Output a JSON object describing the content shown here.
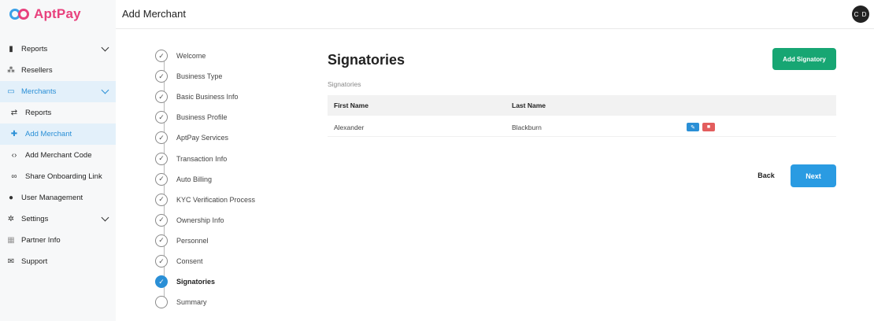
{
  "brand": {
    "name": "AptPay",
    "logo_icon": "aptpay-logo-icon"
  },
  "header": {
    "title": "Add Merchant",
    "avatar_initials": "C D"
  },
  "sidebar": {
    "items": [
      {
        "label": "Reports",
        "icon": "document-icon",
        "has_chevron": true
      },
      {
        "label": "Resellers",
        "icon": "network-icon"
      },
      {
        "label": "Merchants",
        "icon": "wallet-icon",
        "has_chevron": true,
        "active": true
      },
      {
        "label": "Reports",
        "icon": "swap-icon",
        "sub": true
      },
      {
        "label": "Add Merchant",
        "icon": "user-plus-icon",
        "sub": true,
        "active": true
      },
      {
        "label": "Add Merchant Code",
        "icon": "code-icon",
        "sub": true
      },
      {
        "label": "Share Onboarding Link",
        "icon": "link-icon",
        "sub": true
      },
      {
        "label": "User Management",
        "icon": "users-icon"
      },
      {
        "label": "Settings",
        "icon": "gear-icon",
        "has_chevron": true
      },
      {
        "label": "Partner Info",
        "icon": "grid-icon"
      },
      {
        "label": "Support",
        "icon": "mail-icon"
      }
    ]
  },
  "steps": [
    {
      "label": "Welcome",
      "state": "done"
    },
    {
      "label": "Business Type",
      "state": "done"
    },
    {
      "label": "Basic Business Info",
      "state": "done"
    },
    {
      "label": "Business Profile",
      "state": "done"
    },
    {
      "label": "AptPay Services",
      "state": "done"
    },
    {
      "label": "Transaction Info",
      "state": "done"
    },
    {
      "label": "Auto Billing",
      "state": "done"
    },
    {
      "label": "KYC Verification Process",
      "state": "done"
    },
    {
      "label": "Ownership Info",
      "state": "done"
    },
    {
      "label": "Personnel",
      "state": "done"
    },
    {
      "label": "Consent",
      "state": "done"
    },
    {
      "label": "Signatories",
      "state": "active"
    },
    {
      "label": "Summary",
      "state": "pending"
    }
  ],
  "main": {
    "title": "Signatories",
    "add_button": "Add Signatory",
    "table_label": "Signatories",
    "columns": [
      "First Name",
      "Last Name"
    ],
    "rows": [
      {
        "first_name": "Alexander",
        "last_name": "Blackburn"
      }
    ],
    "back_button": "Back",
    "next_button": "Next"
  },
  "colors": {
    "accent": "#2a8fd6",
    "success": "#17a673",
    "danger": "#e35d5d",
    "brand_pink": "#e8417d"
  }
}
